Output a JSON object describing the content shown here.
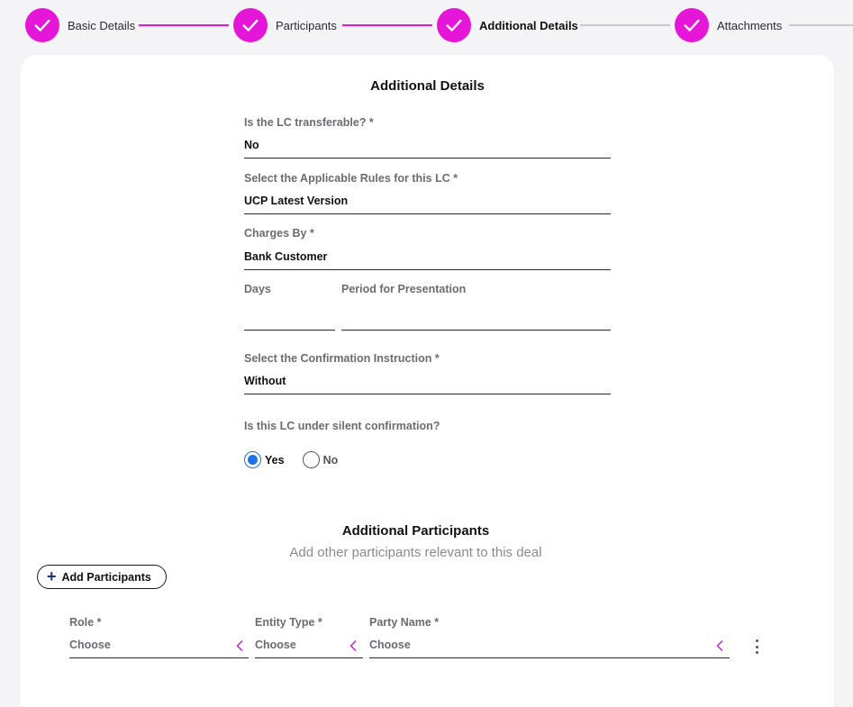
{
  "stepper": {
    "steps": [
      {
        "label": "Basic Details"
      },
      {
        "label": "Participants"
      },
      {
        "label": "Additional Details"
      },
      {
        "label": "Attachments"
      }
    ]
  },
  "colors": {
    "accent": "#e616d8",
    "radio_selected": "#1a73e8",
    "add_plus": "#1e2a8a"
  },
  "additional_details": {
    "title": "Additional Details",
    "transferable": {
      "label": "Is the LC transferable? *",
      "value": "No"
    },
    "applicable_rules": {
      "label": "Select the Applicable Rules for this LC *",
      "value": "UCP Latest Version"
    },
    "charges_by": {
      "label": "Charges By *",
      "value": "Bank Customer"
    },
    "days": {
      "label": "Days",
      "value": ""
    },
    "period": {
      "label": "Period for Presentation",
      "value": ""
    },
    "confirmation": {
      "label": "Select the Confirmation Instruction *",
      "value": "Without"
    },
    "silent": {
      "label": "Is this LC under silent confirmation?",
      "options": [
        {
          "label": "Yes",
          "selected": true
        },
        {
          "label": "No",
          "selected": false
        }
      ]
    }
  },
  "additional_participants": {
    "title": "Additional Participants",
    "subtitle": "Add other participants relevant to this deal",
    "add_button": "Add Participants",
    "role": {
      "label": "Role *",
      "value": "Choose"
    },
    "entity_type": {
      "label": "Entity Type *",
      "value": "Choose"
    },
    "party_name": {
      "label": "Party Name *",
      "value": "Choose"
    }
  },
  "icons": {
    "step_check": "check-icon",
    "add": "plus-icon",
    "select_chevron": "chevron-left-icon",
    "row_menu": "kebab-menu-icon"
  }
}
